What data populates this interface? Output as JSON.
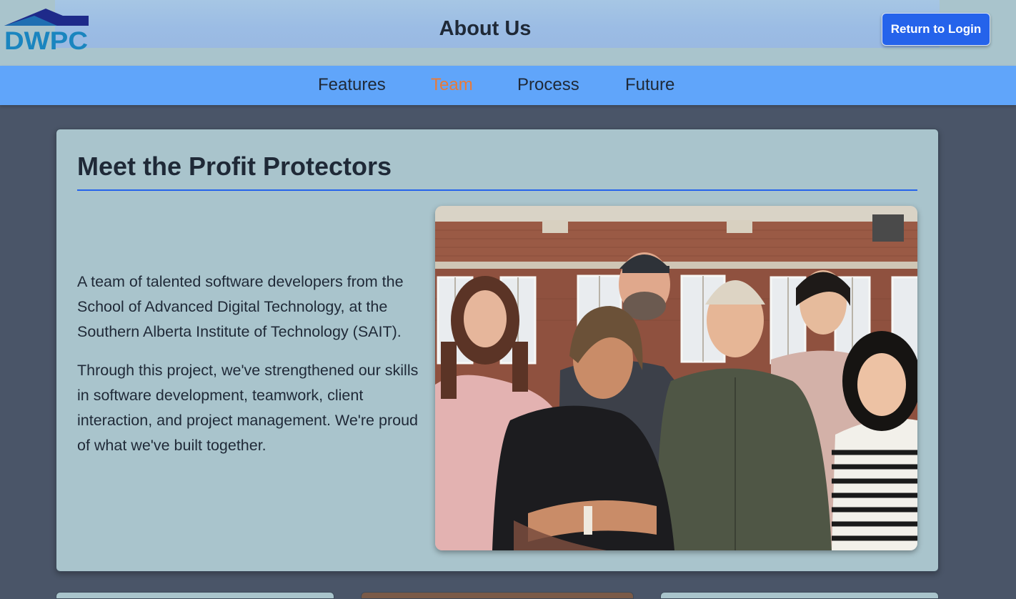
{
  "header": {
    "logo_text": "DWPC",
    "title": "About Us",
    "return_button_label": "Return to Login"
  },
  "nav": {
    "items": [
      {
        "label": "Features"
      },
      {
        "label": "Team"
      },
      {
        "label": "Process"
      },
      {
        "label": "Future"
      }
    ],
    "active_item": "Team"
  },
  "team_section": {
    "heading": "Meet the Profit Protectors",
    "paragraphs": [
      "A team of talented software developers from the School of Advanced Digital Technology, at the Southern Alberta Institute of Technology (SAIT).",
      "Through this project, we've strengthened our skills in software development, teamwork, client interaction, and project management. We're proud of what we've built together."
    ]
  },
  "colors": {
    "nav_bar": "#60a5fa",
    "accent_blue": "#2563eb",
    "active_nav": "#ea7a36",
    "card_bg": "#a9c4cc",
    "page_bg": "#4a5568"
  }
}
